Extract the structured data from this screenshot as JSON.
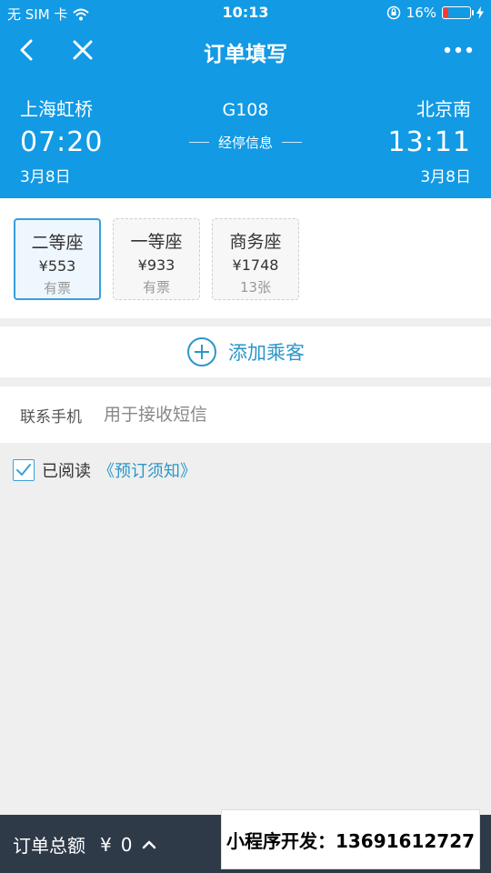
{
  "status_bar": {
    "carrier": "无 SIM 卡",
    "time": "10:13",
    "battery": "16%"
  },
  "nav": {
    "title": "订单填写"
  },
  "train": {
    "from_station": "上海虹桥",
    "depart_time": "07:20",
    "depart_date": "3月8日",
    "train_no": "G108",
    "stop_info": "经停信息",
    "to_station": "北京南",
    "arrive_time": "13:11",
    "arrive_date": "3月8日"
  },
  "seats": [
    {
      "name": "二等座",
      "price": "¥553",
      "availability": "有票",
      "selected": true
    },
    {
      "name": "一等座",
      "price": "¥933",
      "availability": "有票",
      "selected": false
    },
    {
      "name": "商务座",
      "price": "¥1748",
      "availability": "13张",
      "selected": false
    }
  ],
  "add_passenger": {
    "label": "添加乘客"
  },
  "contact": {
    "label": "联系手机",
    "placeholder": "用于接收短信",
    "value": ""
  },
  "agreement": {
    "checked": true,
    "text": "已阅读",
    "link": "《预订须知》"
  },
  "bottom_bar": {
    "total_label": "订单总额",
    "currency": "¥",
    "amount": "0"
  },
  "watermark": {
    "text": "小程序开发：13691612727"
  },
  "colors": {
    "header_bg": "#129ae4",
    "accent": "#2b97c9",
    "bottom_bar_bg": "#2f3a48",
    "page_bg": "#efefef"
  }
}
